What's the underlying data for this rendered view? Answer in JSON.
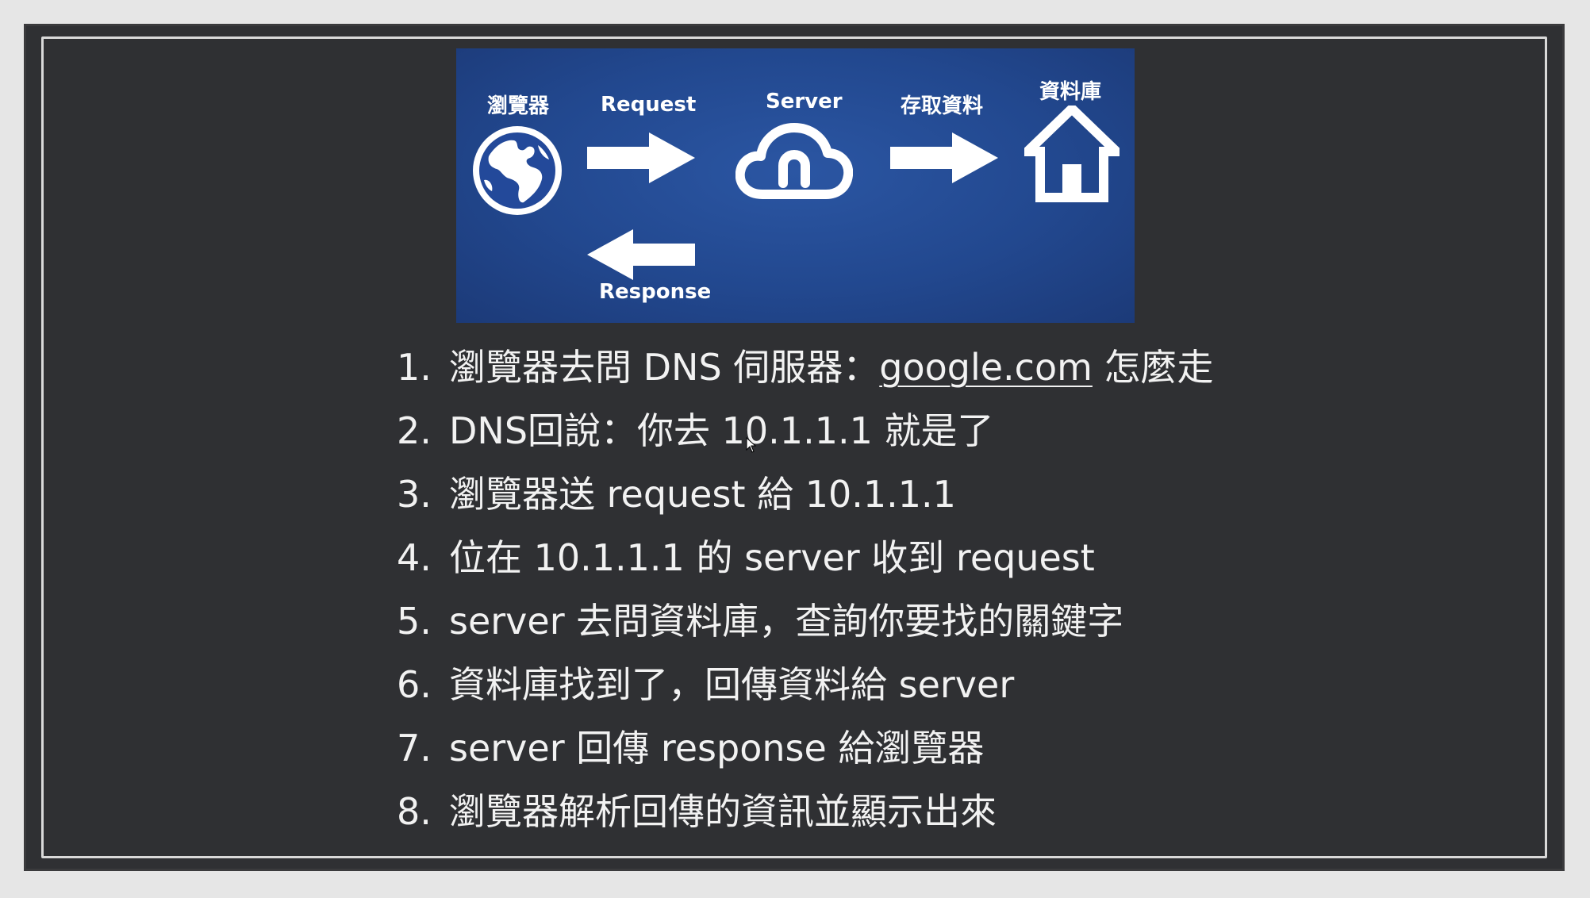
{
  "diagram": {
    "browser_label": "瀏覽器",
    "request_label": "Request",
    "response_label": "Response",
    "server_label": "Server",
    "access_label": "存取資料",
    "database_label": "資料庫",
    "icons": [
      "globe-icon",
      "arrow-right-icon",
      "arrow-left-icon",
      "cloud-icon",
      "arrow-right-icon",
      "house-icon"
    ],
    "background_color": "#22488f"
  },
  "steps": [
    {
      "num": "1.",
      "before": "瀏覽器去問 DNS 伺服器：",
      "link": "google.com",
      "after": " 怎麼走"
    },
    {
      "num": "2.",
      "text": "DNS回說：你去 10.1.1.1 就是了"
    },
    {
      "num": "3.",
      "text": "瀏覽器送 request 給 10.1.1.1"
    },
    {
      "num": "4.",
      "text": "位在 10.1.1.1 的 server 收到 request"
    },
    {
      "num": "5.",
      "text": "server 去問資料庫，查詢你要找的關鍵字"
    },
    {
      "num": "6.",
      "text": "資料庫找到了，回傳資料給 server"
    },
    {
      "num": "7.",
      "text": "server 回傳 response 給瀏覽器"
    },
    {
      "num": "8.",
      "text": "瀏覽器解析回傳的資訊並顯示出來"
    }
  ]
}
